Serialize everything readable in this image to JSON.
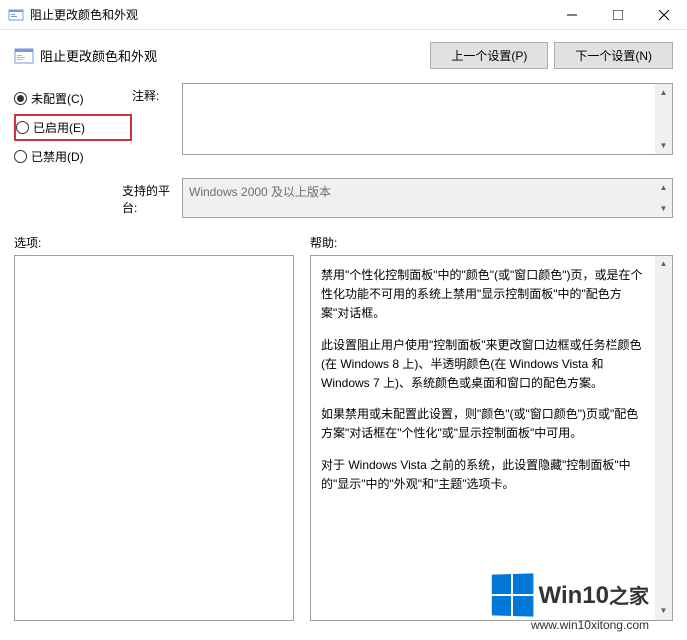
{
  "titlebar": {
    "title": "阻止更改颜色和外观"
  },
  "header": {
    "title": "阻止更改颜色和外观",
    "prev_btn": "上一个设置(P)",
    "next_btn": "下一个设置(N)"
  },
  "radios": {
    "not_configured": "未配置(C)",
    "enabled": "已启用(E)",
    "disabled": "已禁用(D)"
  },
  "labels": {
    "comment": "注释:",
    "platform": "支持的平台:",
    "options": "选项:",
    "help": "帮助:"
  },
  "platform": {
    "value": "Windows 2000 及以上版本"
  },
  "help": {
    "p1": "禁用\"个性化控制面板\"中的\"颜色\"(或\"窗口颜色\")页，或是在个性化功能不可用的系统上禁用\"显示控制面板\"中的\"配色方案\"对话框。",
    "p2": "此设置阻止用户使用\"控制面板\"来更改窗口边框或任务栏颜色(在 Windows 8 上)、半透明颜色(在 Windows Vista 和 Windows 7 上)、系统颜色或桌面和窗口的配色方案。",
    "p3": "如果禁用或未配置此设置，则\"颜色\"(或\"窗口颜色\")页或\"配色方案\"对话框在\"个性化\"或\"显示控制面板\"中可用。",
    "p4": "对于 Windows Vista 之前的系统，此设置隐藏\"控制面板\"中的\"显示\"中的\"外观\"和\"主题\"选项卡。"
  },
  "watermark": {
    "brand": "Win10",
    "suffix": "之家",
    "url": "www.win10xitong.com"
  }
}
